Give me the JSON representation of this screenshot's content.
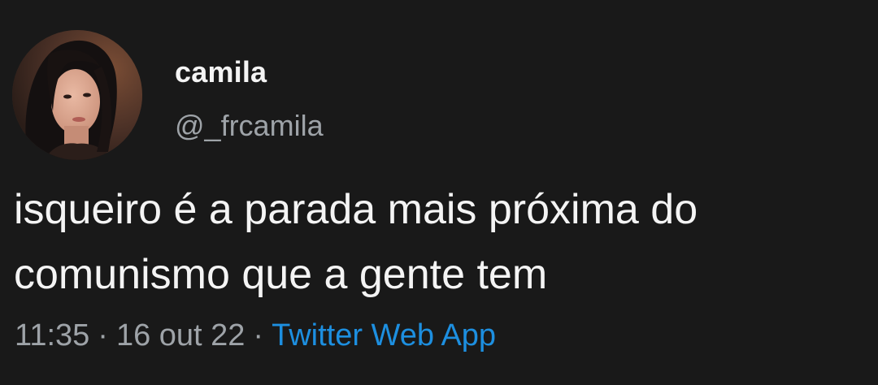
{
  "author": {
    "display_name": "camila",
    "handle": "@_frcamila"
  },
  "tweet": {
    "text": "isqueiro é a parada mais próxima do\ncomunismo que a gente tem",
    "time": "11:35",
    "separator": "·",
    "date": "16 out 22",
    "source": "Twitter Web App"
  },
  "colors": {
    "background": "#191919",
    "text": "#f4f4f4",
    "muted": "#9ea3a8",
    "link": "#1d8fe0"
  }
}
